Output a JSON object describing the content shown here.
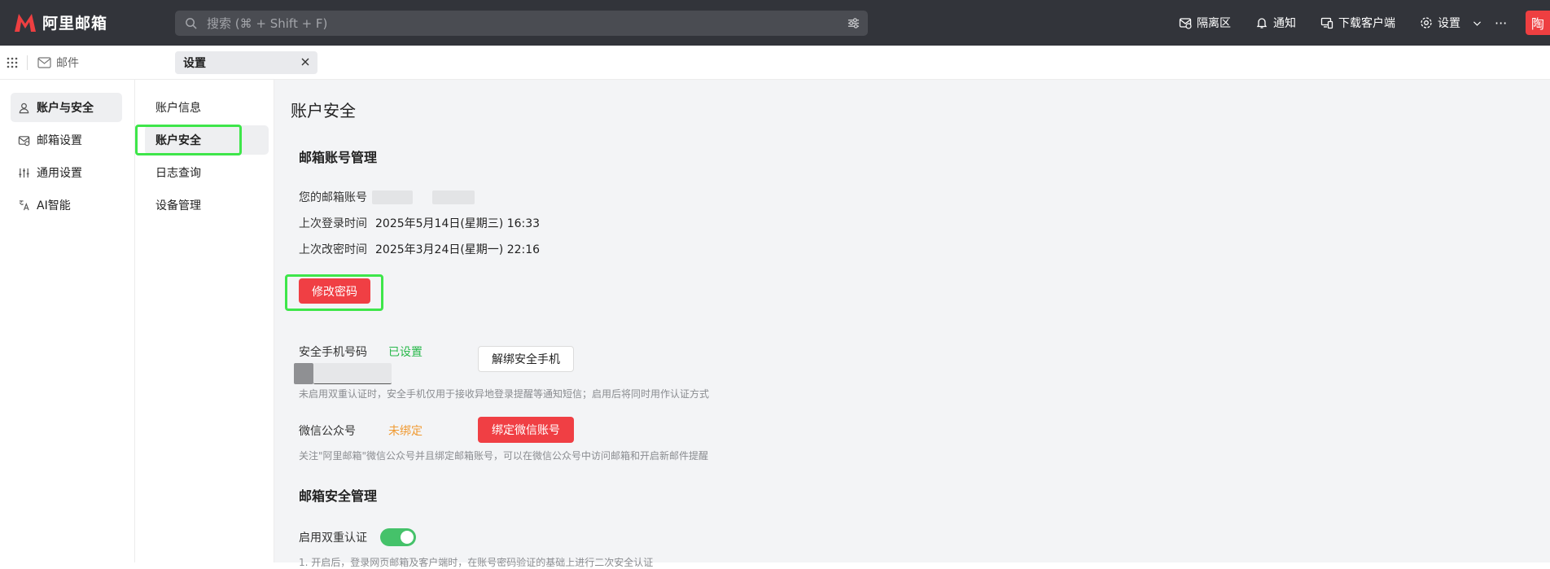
{
  "app": {
    "logo_text": "阿里邮箱"
  },
  "search": {
    "placeholder": "搜索 (⌘ + Shift + F)"
  },
  "topnav": {
    "quarantine": "隔离区",
    "notifications": "通知",
    "download_client": "下载客户端",
    "settings": "设置",
    "more": "···",
    "avatar_text": "陶"
  },
  "tabs": {
    "mail": "邮件",
    "settings": "设置"
  },
  "leftnav": {
    "items": [
      {
        "label": "账户与安全",
        "icon": "user-icon",
        "active": true
      },
      {
        "label": "邮箱设置",
        "icon": "mailbox-settings-icon",
        "active": false
      },
      {
        "label": "通用设置",
        "icon": "sliders-icon",
        "active": false
      },
      {
        "label": "AI智能",
        "icon": "ai-translate-icon",
        "active": false
      }
    ]
  },
  "subnav": {
    "items": [
      {
        "label": "账户信息",
        "active": false
      },
      {
        "label": "账户安全",
        "active": true
      },
      {
        "label": "日志查询",
        "active": false
      },
      {
        "label": "设备管理",
        "active": false
      }
    ]
  },
  "main": {
    "page_title": "账户安全",
    "account_section": {
      "title": "邮箱账号管理",
      "email_label": "您的邮箱账号",
      "last_login_label": "上次登录时间",
      "last_login_value": "2025年5月14日(星期三) 16:33",
      "last_pwd_change_label": "上次改密时间",
      "last_pwd_change_value": "2025年3月24日(星期一) 22:16",
      "change_password_button": "修改密码"
    },
    "phone": {
      "label": "安全手机号码",
      "status": "已设置",
      "unbind_button": "解绑安全手机",
      "hint": "未启用双重认证时，安全手机仅用于接收异地登录提醒等通知短信；启用后将同时用作认证方式"
    },
    "wechat": {
      "label": "微信公众号",
      "status": "未绑定",
      "bind_button": "绑定微信账号",
      "hint": "关注\"阿里邮箱\"微信公众号并且绑定邮箱账号，可以在微信公众号中访问邮箱和开启新邮件提醒"
    },
    "security_section": {
      "title": "邮箱安全管理",
      "two_factor_label": "启用双重认证",
      "two_factor_enabled": true,
      "partial_text": "1. 开启后，登录网页邮箱及客户端时，在账号密码验证的基础上进行二次安全认证"
    }
  },
  "colors": {
    "topbar_bg": "#32343a",
    "accent_red": "#f03f44",
    "status_green": "#28b84b",
    "status_orange": "#f09a32",
    "highlight_green": "#3ee64a",
    "toggle_green": "#45c26a"
  }
}
